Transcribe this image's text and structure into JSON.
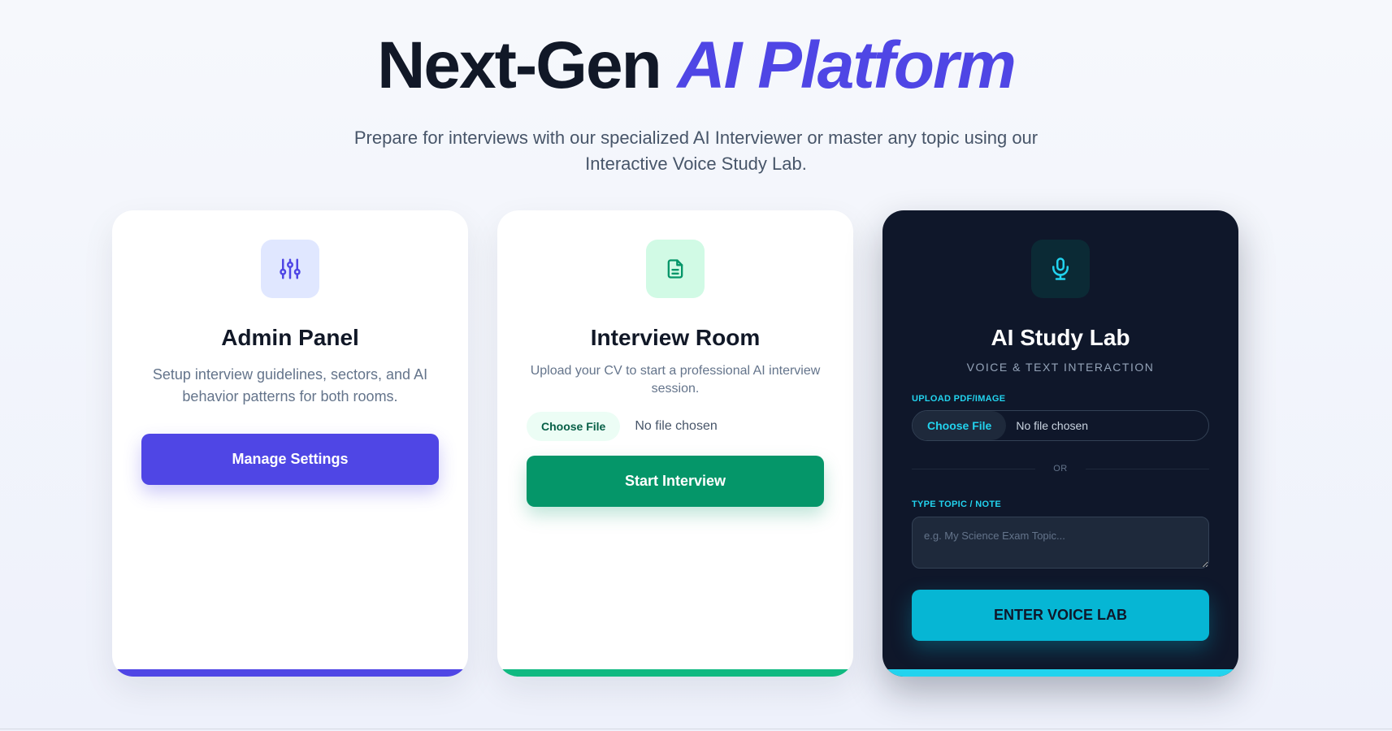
{
  "hero": {
    "title_main": "Next-Gen",
    "title_accent": "AI Platform",
    "subtitle": "Prepare for interviews with our specialized AI Interviewer or master any topic using our Interactive Voice Study Lab."
  },
  "cards": {
    "admin": {
      "icon": "sliders-icon",
      "title": "Admin Panel",
      "description": "Setup interview guidelines, sectors, and AI behavior patterns for both rooms.",
      "button_label": "Manage Settings"
    },
    "interview": {
      "icon": "document-icon",
      "title": "Interview Room",
      "description": "Upload your CV to start a professional AI interview session.",
      "file_button_label": "Choose File",
      "file_status": "No file chosen",
      "button_label": "Start Interview"
    },
    "study": {
      "icon": "microphone-icon",
      "title": "AI Study Lab",
      "subtitle": "VOICE & TEXT INTERACTION",
      "upload_label": "UPLOAD PDF/IMAGE",
      "file_button_label": "Choose File",
      "file_status": "No file chosen",
      "divider_text": "OR",
      "topic_label": "TYPE TOPIC / NOTE",
      "topic_placeholder": "e.g. My Science Exam Topic...",
      "button_label": "ENTER VOICE LAB"
    }
  },
  "colors": {
    "admin_accent": "#4f46e5",
    "interview_accent": "#059669",
    "study_accent": "#06b6d4",
    "study_background": "#0f172a"
  }
}
